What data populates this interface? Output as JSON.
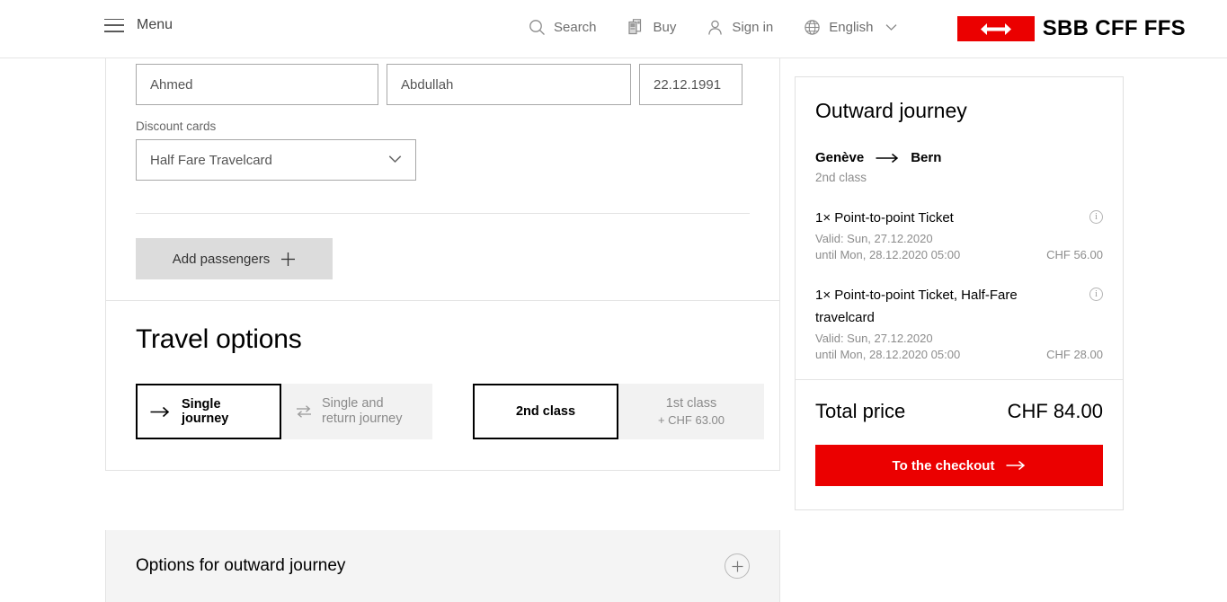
{
  "header": {
    "menu_label": "Menu",
    "nav": [
      {
        "label": "Search",
        "icon": "search-icon"
      },
      {
        "label": "Buy",
        "icon": "ticket-icon"
      },
      {
        "label": "Sign in",
        "icon": "user-icon"
      },
      {
        "label": "English",
        "icon": "globe-icon"
      }
    ],
    "logo_text": "SBB CFF FFS"
  },
  "passenger": {
    "first_name": "Ahmed",
    "last_name": "Abdullah",
    "date_of_birth": "22.12.1991",
    "discount_cards_label": "Discount cards",
    "discount_card_value": "Half Fare Travelcard",
    "add_passengers_label": "Add passengers"
  },
  "travel_options": {
    "title": "Travel options",
    "journey_type": [
      {
        "label": "Single journey",
        "icon": "arrow-right-icon",
        "selected": true
      },
      {
        "label": "Single and return journey",
        "icon": "arrows-exchange-icon",
        "selected": false
      }
    ],
    "travel_class": [
      {
        "label": "2nd class",
        "sublabel": "",
        "selected": true
      },
      {
        "label": "1st class",
        "sublabel": "+ CHF 63.00",
        "selected": false
      }
    ]
  },
  "options_section": {
    "label": "Options for outward journey",
    "expand_icon": "plus-circle-icon"
  },
  "summary": {
    "title": "Outward journey",
    "from": "Genève",
    "to": "Bern",
    "travel_class": "2nd class",
    "tickets": [
      {
        "name": "1× Point-to-point Ticket",
        "valid": "Valid: Sun, 27.12.2020",
        "until": "until Mon, 28.12.2020 05:00",
        "price": "CHF 56.00"
      },
      {
        "name": "1× Point-to-point Ticket, Half-Fare travelcard",
        "valid": "Valid: Sun, 27.12.2020",
        "until": "until Mon, 28.12.2020 05:00",
        "price": "CHF 28.00"
      }
    ],
    "total_label": "Total price",
    "total_value": "CHF 84.00",
    "checkout_label": "To the checkout"
  },
  "colors": {
    "brand_red": "#eb0000",
    "text_muted": "#8d8d8d",
    "border": "#e3e3e3"
  }
}
